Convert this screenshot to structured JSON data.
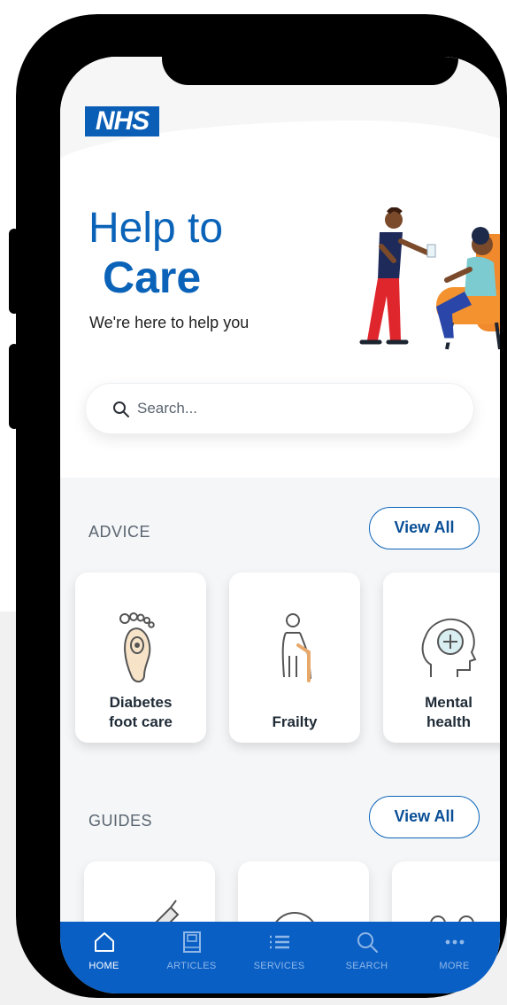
{
  "app": {
    "logo_text": "NHS"
  },
  "hero": {
    "title_line1": "Help to",
    "title_line2": "Care",
    "tagline": "We're here to help you"
  },
  "search": {
    "placeholder": "Search..."
  },
  "advice": {
    "label": "ADVICE",
    "view_all": "View All",
    "cards": [
      {
        "label": "Diabetes\nfoot care",
        "icon": "foot-icon"
      },
      {
        "label": "Frailty",
        "icon": "elderly-walking-stick-icon"
      },
      {
        "label": "Mental\nhealth",
        "icon": "head-plus-icon"
      }
    ]
  },
  "guides": {
    "label": "GUIDES",
    "view_all": "View All"
  },
  "tabbar": {
    "items": [
      {
        "label": "HOME",
        "icon": "home-icon",
        "active": true
      },
      {
        "label": "ARTICLES",
        "icon": "book-icon",
        "active": false
      },
      {
        "label": "SERVICES",
        "icon": "list-icon",
        "active": false
      },
      {
        "label": "SEARCH",
        "icon": "search-icon",
        "active": false
      },
      {
        "label": "MORE",
        "icon": "more-dots-icon",
        "active": false
      }
    ]
  },
  "colors": {
    "brand_blue": "#0a63b8",
    "tabbar_blue": "#0a5fc4"
  }
}
